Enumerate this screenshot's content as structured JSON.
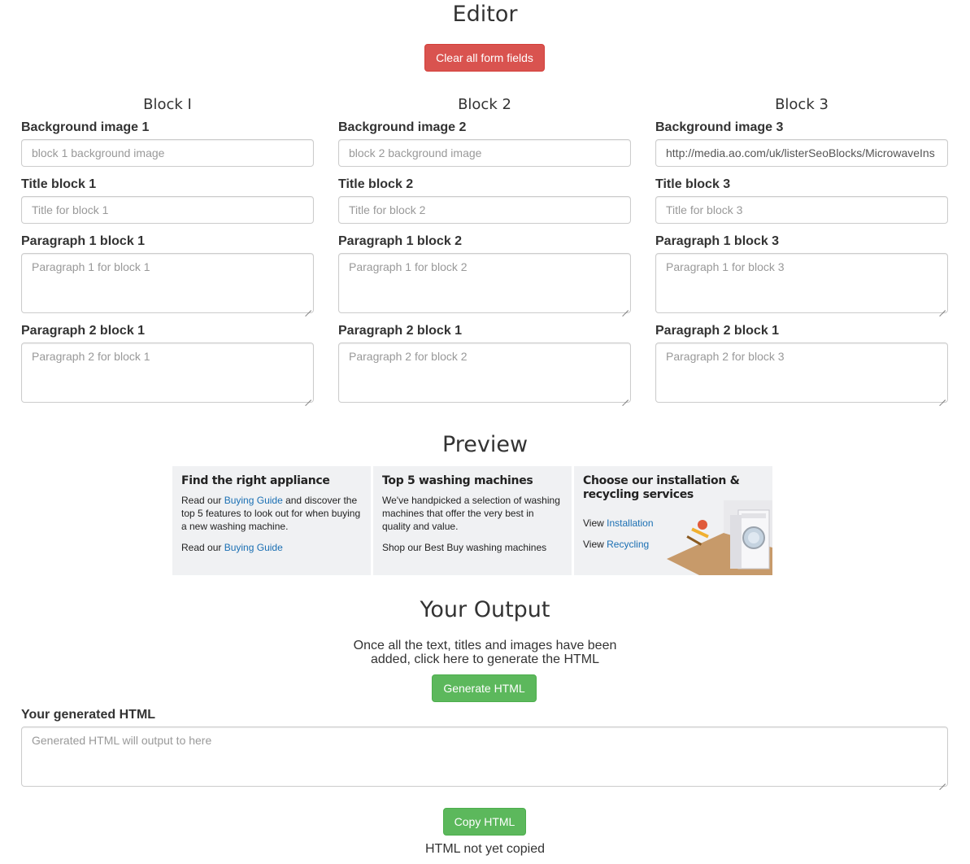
{
  "editor": {
    "title": "Editor",
    "clear_button": "Clear all form fields",
    "blocks": [
      {
        "heading": "Block I",
        "bg_label": "Background image 1",
        "bg_value": "",
        "bg_placeholder": "block 1 background image",
        "title_label": "Title block 1",
        "title_placeholder": "Title for block 1",
        "p1_label": "Paragraph 1 block 1",
        "p1_placeholder": "Paragraph 1 for block 1",
        "p2_label": "Paragraph 2 block 1",
        "p2_placeholder": "Paragraph 2 for block 1"
      },
      {
        "heading": "Block 2",
        "bg_label": "Background image 2",
        "bg_value": "",
        "bg_placeholder": "block 2 background image",
        "title_label": "Title block 2",
        "title_placeholder": "Title for block 2",
        "p1_label": "Paragraph 1 block 2",
        "p1_placeholder": "Paragraph 1 for block 2",
        "p2_label": "Paragraph 2 block 1",
        "p2_placeholder": "Paragraph 2 for block 2"
      },
      {
        "heading": "Block 3",
        "bg_label": "Background image 3",
        "bg_value": "http://media.ao.com/uk/listerSeoBlocks/MicrowaveIns",
        "bg_placeholder": "block 3 background image",
        "title_label": "Title block 3",
        "title_placeholder": "Title for block 3",
        "p1_label": "Paragraph 1 block 3",
        "p1_placeholder": "Paragraph 1 for block 3",
        "p2_label": "Paragraph 2 block 1",
        "p2_placeholder": "Paragraph 2 for block 3"
      }
    ]
  },
  "preview": {
    "title": "Preview",
    "card1": {
      "title": "Find the right appliance",
      "text_before": "Read our ",
      "link1": "Buying Guide",
      "text_after": " and discover the top 5 features to look out for when buying a new washing machine.",
      "line2_before": "Read our ",
      "link2": "Buying Guide"
    },
    "card2": {
      "title": "Top 5 washing machines",
      "text": "We've handpicked a selection of washing machines that offer the very best in quality and value.",
      "link": "Shop our Best Buy washing machines"
    },
    "card3": {
      "title": "Choose our installation & recycling services",
      "view1": "View ",
      "link1": "Installation",
      "view2": "View ",
      "link2": "Recycling"
    }
  },
  "output": {
    "title": "Your Output",
    "desc_line1": "Once all the text, titles and images have been",
    "desc_line2": "added, click here to generate the HTML",
    "generate_button": "Generate HTML",
    "generated_label": "Your generated HTML",
    "generated_placeholder": "Generated HTML will output to here",
    "copy_button": "Copy HTML",
    "copy_status": "HTML not yet copied"
  },
  "colors": {
    "danger": "#d9534f",
    "success": "#5cb85c",
    "link": "#1a6fb3",
    "preview_bg": "#f0f1f3"
  }
}
